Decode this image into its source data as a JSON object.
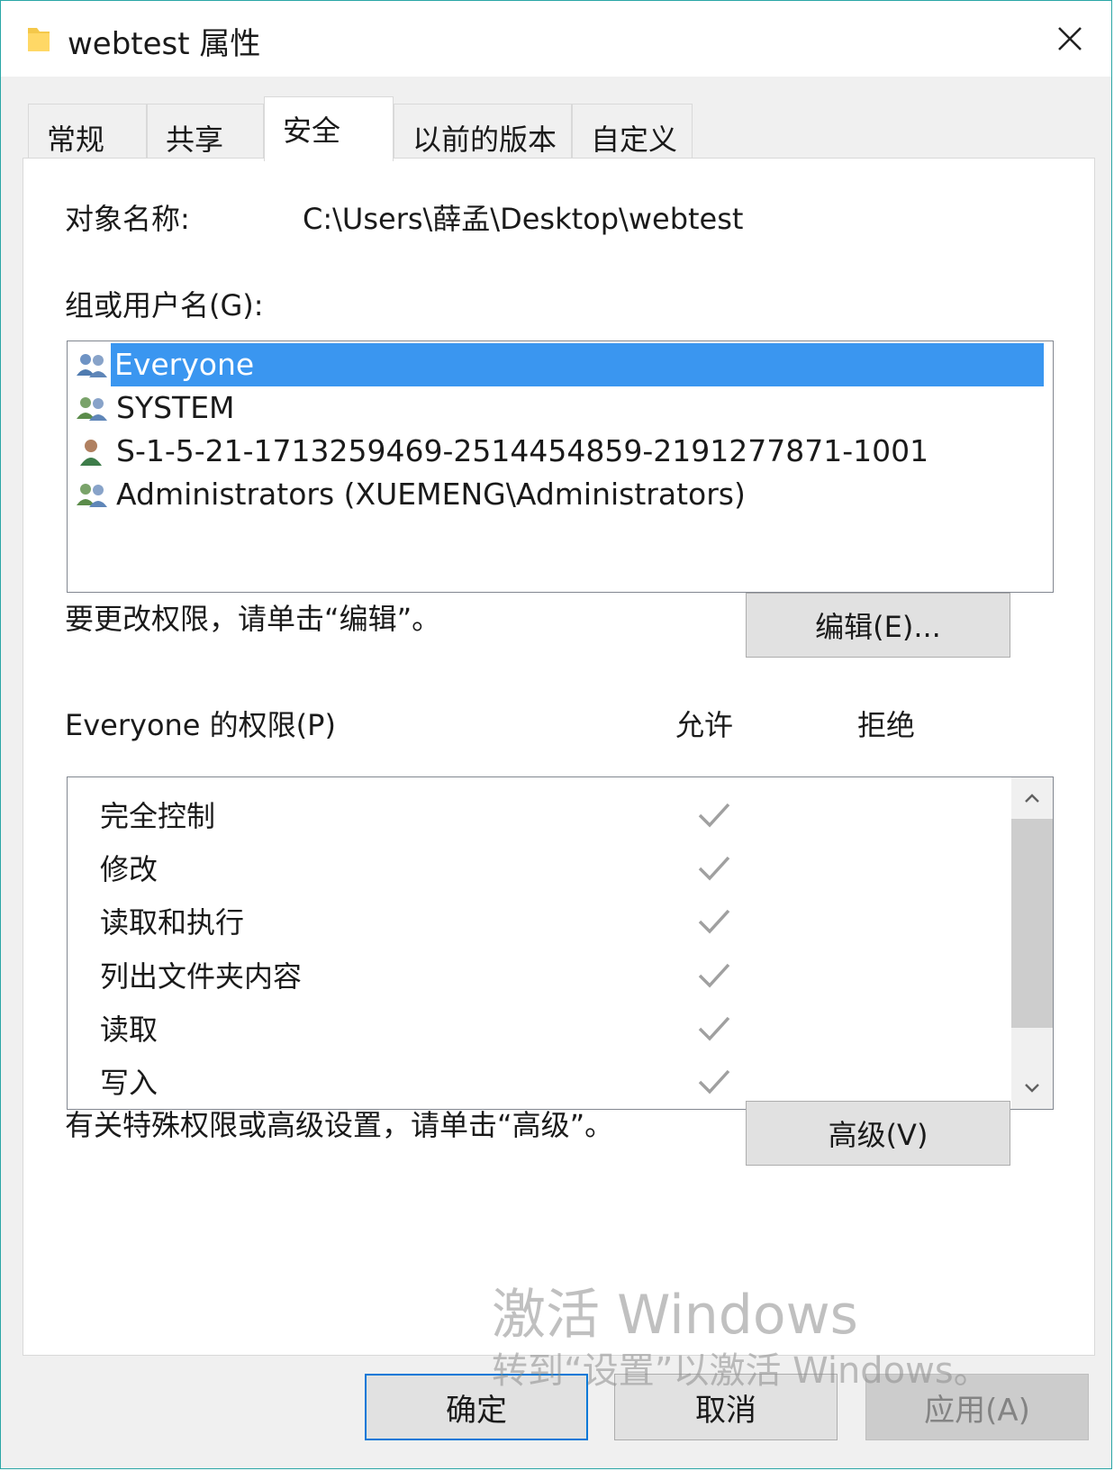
{
  "window": {
    "title": "webtest 属性",
    "close_label": "×"
  },
  "tabs": [
    {
      "label": "常规",
      "active": false
    },
    {
      "label": "共享",
      "active": false
    },
    {
      "label": "安全",
      "active": true
    },
    {
      "label": "以前的版本",
      "active": false
    },
    {
      "label": "自定义",
      "active": false
    }
  ],
  "security": {
    "object_name_label": "对象名称:",
    "object_name_value": "C:\\Users\\薛孟\\Desktop\\webtest",
    "groups_label": "组或用户名(G):",
    "groups": [
      {
        "name": "Everyone",
        "icon": "group-users-icon",
        "selected": true
      },
      {
        "name": "SYSTEM",
        "icon": "group-users-icon",
        "selected": false
      },
      {
        "name": "S-1-5-21-1713259469-2514454859-2191277871-1001",
        "icon": "single-user-icon",
        "selected": false
      },
      {
        "name": "Administrators (XUEMENG\\Administrators)",
        "icon": "group-users-icon",
        "selected": false
      }
    ],
    "edit_hint": "要更改权限，请单击“编辑”。",
    "edit_button": "编辑(E)...",
    "permissions_label": "Everyone 的权限(P)",
    "allow_header": "允许",
    "deny_header": "拒绝",
    "permissions": [
      {
        "name": "完全控制",
        "allow": true,
        "deny": false
      },
      {
        "name": "修改",
        "allow": true,
        "deny": false
      },
      {
        "name": "读取和执行",
        "allow": true,
        "deny": false
      },
      {
        "name": "列出文件夹内容",
        "allow": true,
        "deny": false
      },
      {
        "name": "读取",
        "allow": true,
        "deny": false
      },
      {
        "name": "写入",
        "allow": true,
        "deny": false
      }
    ],
    "advanced_hint": "有关特殊权限或高级设置，请单击“高级”。",
    "advanced_button": "高级(V)"
  },
  "watermark": {
    "line1": "激活 Windows",
    "line2": "转到“设置”以激活 Windows。"
  },
  "buttons": {
    "ok": "确定",
    "cancel": "取消",
    "apply": "应用(A)"
  },
  "colors": {
    "selection": "#3a96f0",
    "check": "#a0a0a0",
    "window_border": "#2aa6a6"
  }
}
